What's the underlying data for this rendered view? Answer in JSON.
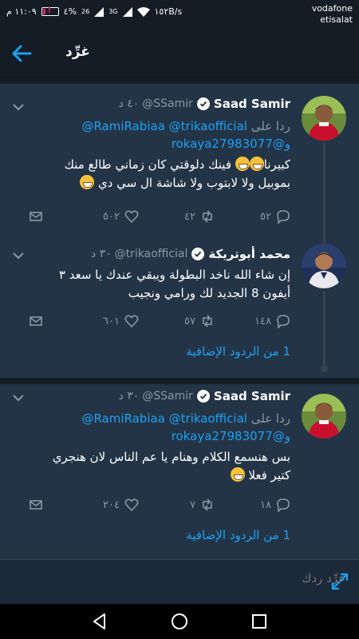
{
  "status_bar": {
    "time": "١١:٠٩ م",
    "battery_percent": "٤%",
    "signal_1": "26",
    "signal_2": "3G",
    "speed": "١٥٢B/s",
    "carrier_1": "vodafone",
    "carrier_2": "etisalat"
  },
  "header": {
    "title": "غرِّد"
  },
  "tweets": [
    {
      "name": "Saad Samir",
      "handle": "@SSamir",
      "time": "٤٠ د",
      "reply_prefix": "ردا على",
      "mentions_line1": "@RamiRabiaa @trikaofficial",
      "mentions_line2": "و@rokaya27983077",
      "text_line1": "كبيرنا",
      "text_line1b": "فينك دلوقتي كان زماني طالع منك",
      "text_line2": "بموبيل ولا لابتوب ولا شاشة ال سي دي",
      "replies": "٥٢",
      "retweets": "٤٢",
      "likes": "٥٠٢"
    },
    {
      "name": "محمد أبوتريكة",
      "handle": "@trikaofficial",
      "time": "٣٠ د",
      "text_line1": "إن شاء الله ناخد البطولة ويبقي عندك يا سعد ٣",
      "text_line2": "أيفون 8 الجديد لك ورامي ونجيب",
      "replies": "١٤٨",
      "retweets": "٥٧",
      "likes": "٦٠١",
      "more_replies": "1 من الردود الإضافية"
    },
    {
      "name": "Saad Samir",
      "handle": "@SSamir",
      "time": "٣٠ د",
      "reply_prefix": "ردا على",
      "mentions_line1": "@RamiRabiaa @trikaofficial",
      "mentions_line2": "و@rokaya27983077",
      "text_line1": "بس هنسمع الكلام وهنام يا عم الناس لان هنجري",
      "text_line2": "كتير فعلا",
      "replies": "١٨",
      "retweets": "٧",
      "likes": "٢٠٤",
      "more_replies": "1 من الردود الإضافية"
    }
  ],
  "composer": {
    "placeholder": "غرِّد ردك"
  },
  "colors": {
    "background": "#243447",
    "accent": "#1da1f2",
    "muted": "#8899a6"
  }
}
